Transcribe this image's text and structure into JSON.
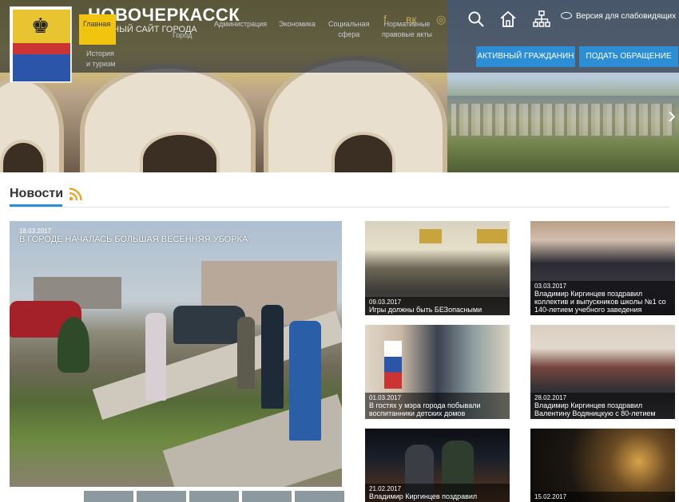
{
  "header": {
    "title": "НОВОЧЕРКАССК",
    "subtitle": "...АЛЬНЫЙ САЙТ ГОРОДА",
    "nav": [
      {
        "label": "Главная"
      },
      {
        "label": "История\nи туризм"
      },
      {
        "label": "Город"
      },
      {
        "label": "Администрация"
      },
      {
        "label": "Экономика"
      },
      {
        "label": "Социальная\nсфера"
      },
      {
        "label": "Нормативные\nправовые акты"
      }
    ],
    "social_icons": [
      "facebook-icon",
      "vk-icon",
      "instagram-icon"
    ],
    "social_glyphs": [
      "f",
      "вк",
      "◎"
    ],
    "accessible_label": "Версия для слабовидящих",
    "btn_active_citizen": "АКТИВНЫЙ ГРАЖДАНИН",
    "btn_appeal": "ПОДАТЬ ОБРАЩЕНИЕ",
    "hero_next": "›"
  },
  "news": {
    "heading": "Новости",
    "feature": {
      "date": "18.03.2017",
      "title": "В ГОРОДЕ НАЧАЛАСЬ БОЛЬШАЯ ВЕСЕННЯЯ УБОРКА"
    },
    "cards": [
      {
        "date": "09.03.2017",
        "title": "Игры должны быть БЕЗопасными"
      },
      {
        "date": "03.03.2017",
        "title": "Владимир Киргинцев поздравил коллектив и выпускников школы №1 со 140-летием учебного заведения"
      },
      {
        "date": "01.03.2017",
        "title": "В гостях у мэра города побывали воспитанники детских домов"
      },
      {
        "date": "28.02.2017",
        "title": "Владимир Киргинцев поздравил Валентину Водяницкую с 80-летием"
      },
      {
        "date": "21.02.2017",
        "title": "Владимир Киргинцев поздравил"
      },
      {
        "date": "15.02.2017",
        "title": ""
      }
    ]
  },
  "colors": {
    "accent": "#2c8fd6",
    "nav_active": "#f1c40f",
    "rss": "#f39c12"
  }
}
